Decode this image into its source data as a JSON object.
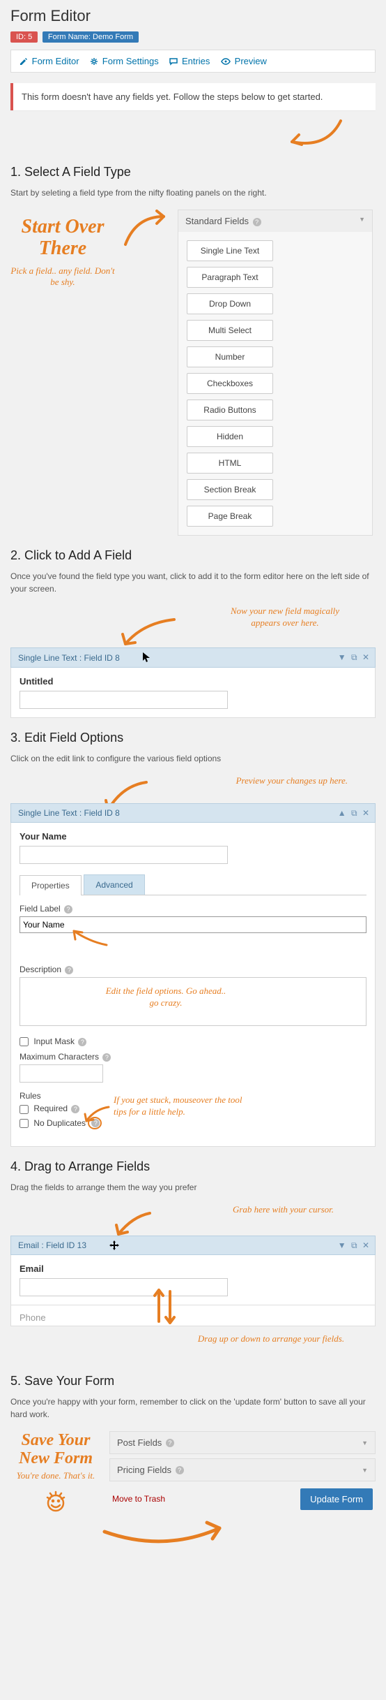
{
  "header": {
    "title": "Form Editor",
    "id_label": "ID: 5",
    "name_label": "Form Name: Demo Form"
  },
  "tabs": {
    "editor": "Form Editor",
    "settings": "Form Settings",
    "entries": "Entries",
    "preview": "Preview"
  },
  "notice": "This form doesn't have any fields yet. Follow the steps below to get started.",
  "step1": {
    "heading": "1. Select A Field Type",
    "intro": "Start by seleting a field type from the nifty floating panels on the right.",
    "handwriting_title": "Start Over There",
    "handwriting_sub": "Pick a field.. any field. Don't be shy.",
    "panel_title": "Standard Fields",
    "fields": [
      "Single Line Text",
      "Paragraph Text",
      "Drop Down",
      "Multi Select",
      "Number",
      "Checkboxes",
      "Radio Buttons",
      "Hidden",
      "HTML",
      "Section Break",
      "Page Break"
    ]
  },
  "step2": {
    "heading": "2. Click to Add A Field",
    "intro": "Once you've found the field type you want, click to add it to the form editor here on the left side of your screen.",
    "handwriting": "Now your new field magically appears over here.",
    "bar": "Single Line Text : Field ID 8",
    "field_label": "Untitled"
  },
  "step3": {
    "heading": "3. Edit Field Options",
    "intro": "Click on the edit link to configure the various field options",
    "handwriting_top": "Preview your changes up here.",
    "bar": "Single Line Text : Field ID 8",
    "preview_label": "Your Name",
    "tab_properties": "Properties",
    "tab_advanced": "Advanced",
    "label_fieldlabel": "Field Label",
    "value_fieldlabel": "Your Name",
    "label_description": "Description",
    "handwriting_mid": "Edit the field options. Go ahead.. go crazy.",
    "check_inputmask": "Input Mask",
    "label_maxchars": "Maximum Characters",
    "label_rules": "Rules",
    "check_required": "Required",
    "check_nodup": "No Duplicates",
    "handwriting_rules": "If you get stuck, mouseover the tool tips for a little help."
  },
  "step4": {
    "heading": "4. Drag to Arrange Fields",
    "intro": "Drag the fields to arrange them the way you prefer",
    "handwriting_top": "Grab here with your cursor.",
    "bar": "Email : Field ID 13",
    "field_email": "Email",
    "field_phone": "Phone",
    "handwriting_bottom": "Drag up or down to arrange your fields."
  },
  "step5": {
    "heading": "5. Save Your Form",
    "intro": "Once you're happy with your form, remember to click on the 'update form' button to save all your hard work.",
    "handwriting_title": "Save Your New Form",
    "handwriting_sub": "You're done. That's it.",
    "accordion_post": "Post Fields",
    "accordion_pricing": "Pricing Fields",
    "trash": "Move to Trash",
    "update": "Update Form"
  }
}
